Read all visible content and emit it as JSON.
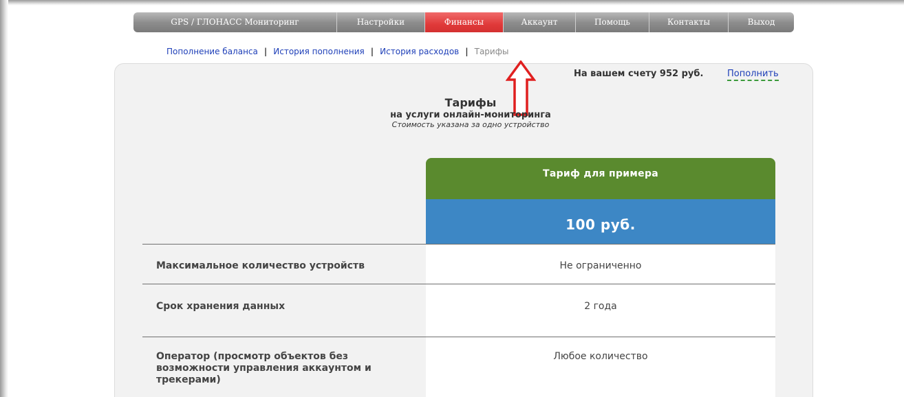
{
  "topnav": {
    "items": [
      {
        "label": "GPS / ГЛОНАСС Мониторинг",
        "active": false
      },
      {
        "label": "Настройки",
        "active": false
      },
      {
        "label": "Финансы",
        "active": true
      },
      {
        "label": "Аккаунт",
        "active": false
      },
      {
        "label": "Помощь",
        "active": false
      },
      {
        "label": "Контакты",
        "active": false
      },
      {
        "label": "Выход",
        "active": false
      }
    ]
  },
  "subnav": {
    "balance_topup": "Пополнение баланса",
    "topup_history": "История пополнения",
    "expense_history": "История расходов",
    "tariffs": "Тарифы",
    "separator": "|"
  },
  "account": {
    "balance_text": "На вашем счету 952 руб.",
    "topup_link": "Пополнить"
  },
  "heading": {
    "title": "Тарифы",
    "subtitle": "на услуги онлайн-мониторинга",
    "note": "Стоимость указана за одно устройство"
  },
  "tariff": {
    "name": "Тариф для примера",
    "price": "100 руб."
  },
  "features": [
    {
      "label": "Максимальное количество устройств",
      "value": "Не ограниченно"
    },
    {
      "label": "Срок хранения данных",
      "value": "2 года"
    },
    {
      "label": "Оператор (просмотр объектов без возможности управления аккаунтом и трекерами)",
      "value": "Любое количество"
    }
  ],
  "colors": {
    "nav_active": "#e03a3a",
    "tariff_header": "#5a8a2e",
    "tariff_price": "#3d87c5",
    "annotation_arrow": "#e02020",
    "link": "#1e3fb8"
  }
}
